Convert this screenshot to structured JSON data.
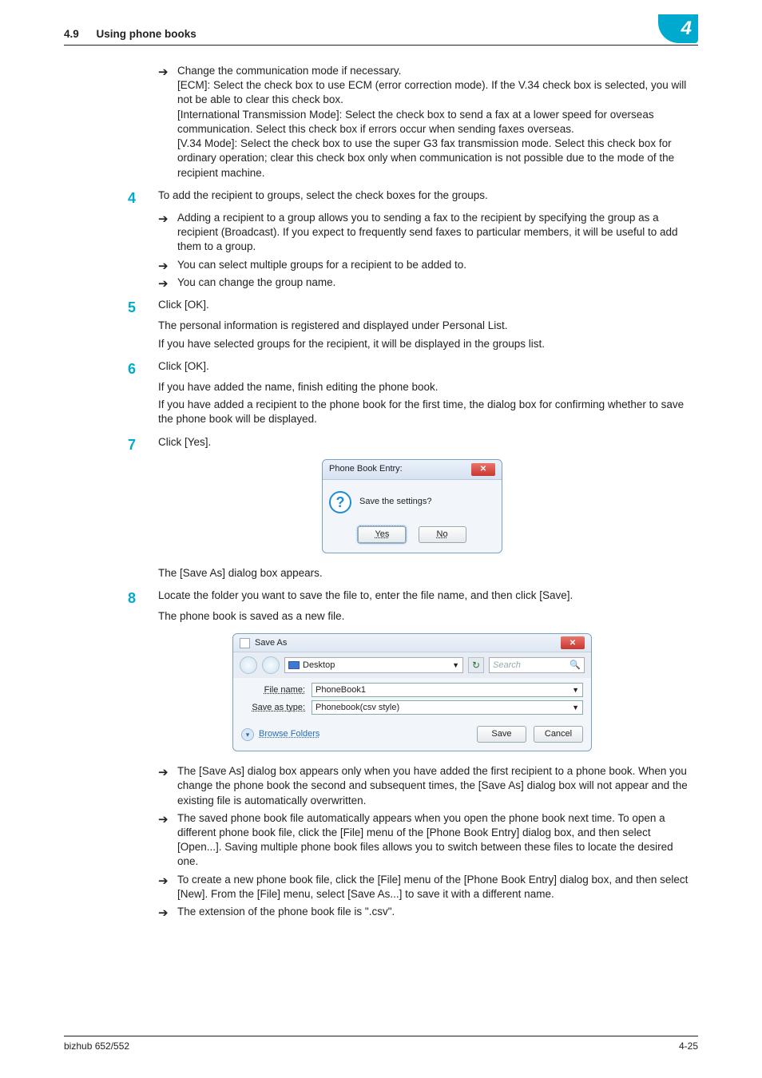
{
  "header": {
    "section_number": "4.9",
    "section_title": "Using phone books",
    "chapter_number": "4"
  },
  "step3_bullets": [
    {
      "lead": "Change the communication mode if necessary.",
      "details": [
        "[ECM]: Select the check box to use ECM (error correction mode). If the V.34 check box is selected, you will not be able to clear this check box.",
        "[International Transmission Mode]: Select the check box to send a fax at a lower speed for overseas communication. Select this check box if errors occur when sending faxes overseas.",
        "[V.34 Mode]: Select the check box to use the super G3 fax transmission mode. Select this check box for ordinary operation; clear this check box only when communication is not possible due to the mode of the recipient machine."
      ]
    }
  ],
  "steps": {
    "s4": {
      "num": "4",
      "text": "To add the recipient to groups, select the check boxes for the groups.",
      "subs": [
        "Adding a recipient to a group allows you to sending a fax to the recipient by specifying the group as a recipient (Broadcast). If you expect to frequently send faxes to particular members, it will be useful to add them to a group.",
        "You can select multiple groups for a recipient to be added to.",
        "You can change the group name."
      ]
    },
    "s5": {
      "num": "5",
      "text": "Click [OK].",
      "after": [
        "The personal information is registered and displayed under Personal List.",
        "If you have selected groups for the recipient, it will be displayed in the groups list."
      ]
    },
    "s6": {
      "num": "6",
      "text": "Click [OK].",
      "after": [
        "If you have added the name, finish editing the phone book.",
        "If you have added a recipient to the phone book for the first time, the dialog box for confirming whether to save the phone book will be displayed."
      ]
    },
    "s7": {
      "num": "7",
      "text": "Click [Yes].",
      "after_fig": "The [Save As] dialog box appears."
    },
    "s8": {
      "num": "8",
      "text": "Locate the folder you want to save the file to, enter the file name, and then click [Save].",
      "after": [
        "The phone book is saved as a new file."
      ],
      "subs": [
        "The [Save As] dialog box appears only when you have added the first recipient to a phone book. When you change the phone book the second and subsequent times, the [Save As] dialog box will not appear and the existing file is automatically overwritten.",
        "The saved phone book file automatically appears when you open the phone book next time. To open a different phone book file, click the [File] menu of the [Phone Book Entry] dialog box, and then select [Open...]. Saving multiple phone book files allows you to switch between these files to locate the desired one.",
        "To create a new phone book file, click the [File] menu of the [Phone Book Entry] dialog box, and then select [New]. From the [File] menu, select [Save As...] to save it with a different name.",
        "The extension of the phone book file is \".csv\"."
      ]
    }
  },
  "dialog1": {
    "title": "Phone Book Entry:",
    "message": "Save the settings?",
    "yes": "Yes",
    "no": "No"
  },
  "dialog2": {
    "title": "Save As",
    "path": "Desktop",
    "search_placeholder": "Search",
    "filename_label": "File name:",
    "filename_value": "PhoneBook1",
    "filetype_label": "Save as type:",
    "filetype_value": "Phonebook(csv style)",
    "browse_folders": "Browse Folders",
    "save": "Save",
    "cancel": "Cancel"
  },
  "footer": {
    "left": "bizhub 652/552",
    "right": "4-25"
  }
}
